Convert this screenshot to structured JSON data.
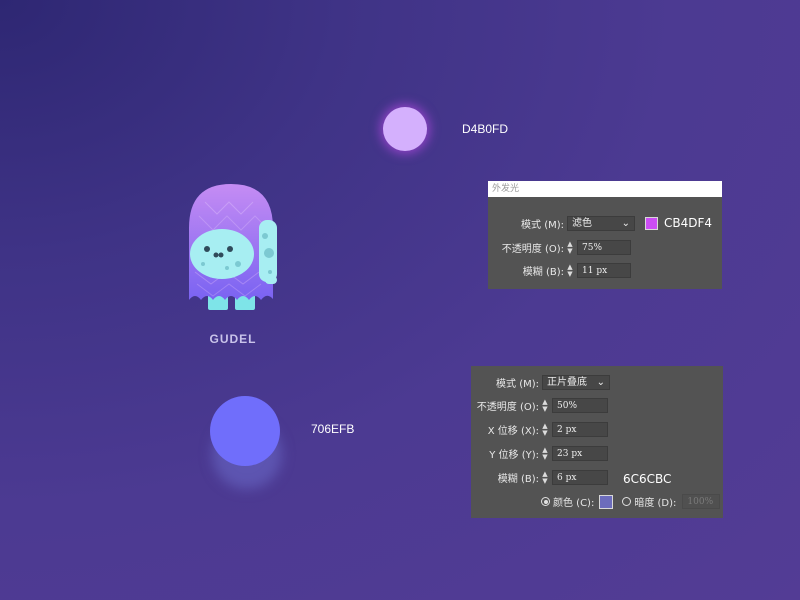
{
  "glow_swatch": {
    "hex_label": "D4B0FD",
    "color": "#D4B0FD"
  },
  "character": {
    "name": "GUDEL"
  },
  "shadow_swatch": {
    "hex_label": "706EFB",
    "color": "#706EFB"
  },
  "outer_glow_panel": {
    "title": "外发光",
    "mode_label": "模式 (M):",
    "mode_value": "滤色",
    "color_hex": "CB4DF4",
    "color": "#CB4DF4",
    "opacity_label": "不透明度 (O):",
    "opacity_value": "75%",
    "blur_label": "模糊 (B):",
    "blur_value": "11 px"
  },
  "drop_shadow_panel": {
    "mode_label": "模式 (M):",
    "mode_value": "正片叠底",
    "opacity_label": "不透明度 (O):",
    "opacity_value": "50%",
    "x_offset_label": "X 位移 (X):",
    "x_offset_value": "2 px",
    "y_offset_label": "Y 位移 (Y):",
    "y_offset_value": "23 px",
    "blur_label": "模糊 (B):",
    "blur_value": "6 px",
    "color_hex": "6C6CBC",
    "color_radio_label": "颜色 (C):",
    "color": "#6C6CBC",
    "darkness_radio_label": "暗度 (D):",
    "darkness_value": "100%"
  }
}
